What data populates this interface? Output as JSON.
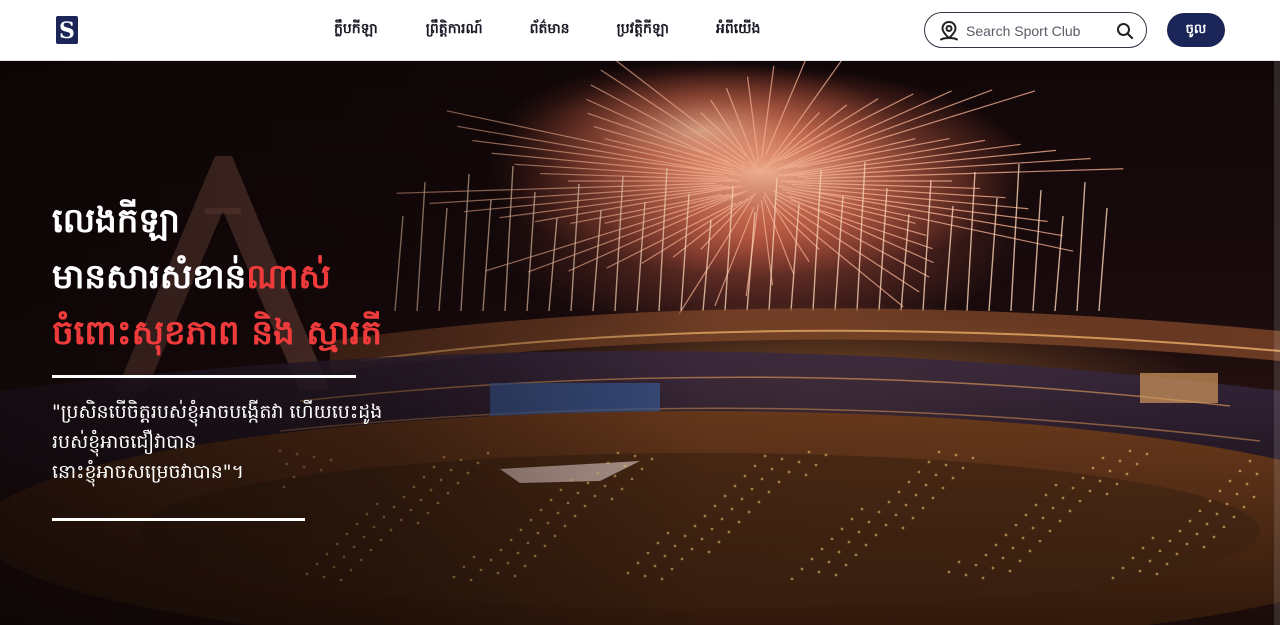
{
  "header": {
    "logo_letter": "S",
    "nav": [
      "ក្លឹបកីឡា",
      "ព្រឹត្តិការណ៍",
      "ព័ត៌មាន",
      "ប្រវត្តិកីឡា",
      "អំពីយើង"
    ],
    "search_placeholder": "Search Sport Club",
    "login_label": "ចូល"
  },
  "hero": {
    "headline_line1": "លេងកីឡា",
    "headline_line2_white": "មានសារសំខាន់",
    "headline_line2_red": "ណាស់",
    "headline_line3": "ចំពោះសុខភាព និង ស្មារតី",
    "quote_line1": "\"ប្រសិនបើចិត្តរបស់ខ្ញុំអាចបង្កើតវា ហើយបេះដូង",
    "quote_line2": "របស់ខ្ញុំអាចជឿវាបាន",
    "quote_line3": "នោះខ្ញុំអាចសម្រេចវាបាន\"។"
  },
  "colors": {
    "accent_red": "#ef3b3b",
    "brand_navy": "#1b2557"
  },
  "icons": {
    "logo": "sport-club-logo-icon",
    "search_location": "location-pin-icon",
    "search_submit": "search-icon"
  }
}
